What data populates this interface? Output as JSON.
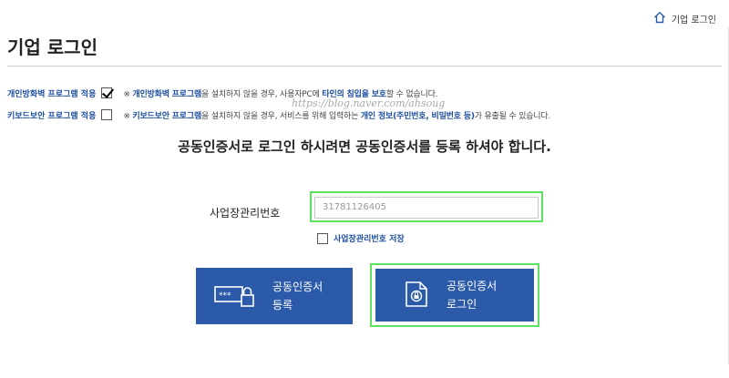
{
  "breadcrumb": {
    "home_label": "기업 로그인"
  },
  "title": "기업 로그인",
  "options": [
    {
      "label": "개인방화벽 프로그램 적용",
      "checked": true,
      "note_parts": [
        {
          "text": "※ ",
          "hl": false
        },
        {
          "text": "개인방화벽 프로그램",
          "hl": true
        },
        {
          "text": "을 설치하지 않을 경우, 사용자PC에 ",
          "hl": false
        },
        {
          "text": "타인의 침입을 보호",
          "hl": true
        },
        {
          "text": "할 수 없습니다.",
          "hl": false
        }
      ]
    },
    {
      "label": "키보드보안 프로그램 적용",
      "checked": false,
      "note_parts": [
        {
          "text": "※ ",
          "hl": false
        },
        {
          "text": "키보드보안 프로그램",
          "hl": true
        },
        {
          "text": "을 설치하지 않을 경우, 서비스를 위해 입력하는 ",
          "hl": false
        },
        {
          "text": "개인 정보(주민번호, 비밀번호 등)",
          "hl": true
        },
        {
          "text": "가 유출될 수 있습니다.",
          "hl": false
        }
      ]
    }
  ],
  "watermark": "https://blog.naver.com/ahsoug",
  "headline": "공동인증서로 로그인 하시려면 공동인증서를 등록 하셔야 합니다.",
  "business": {
    "label": "사업장관리번호",
    "value": "31781126405",
    "save_label": "사업장관리번호 저장",
    "save_checked": false
  },
  "buttons": {
    "register_line1": "공동인증서",
    "register_line2": "등록",
    "login_line1": "공동인증서",
    "login_line2": "로그인"
  },
  "colors": {
    "primary_button": "#2b5aa8",
    "highlight_frame": "#5fe05f",
    "link_blue": "#1f4fa0"
  },
  "icons": {
    "home": "home-icon",
    "register": "password-lock-icon",
    "login": "certificate-lock-icon"
  }
}
